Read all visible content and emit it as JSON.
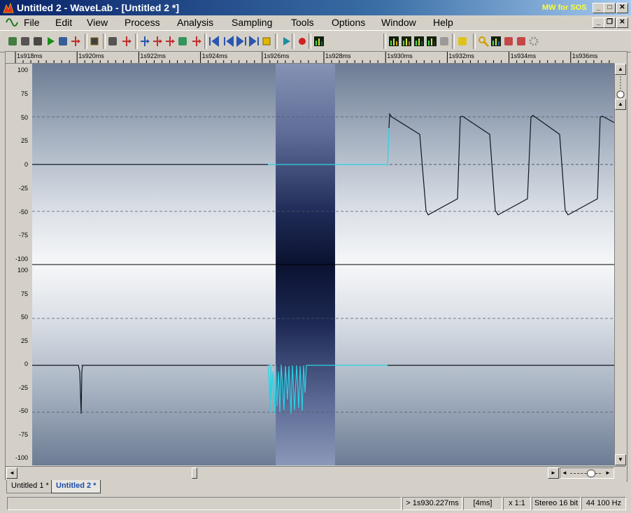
{
  "window": {
    "title": "Untitled 2 - WaveLab - [Untitled 2 *]",
    "brand": "MW for SOS",
    "controls": {
      "minimize": "_",
      "maximize": "□",
      "close": "✕"
    },
    "mdi_controls": {
      "minimize": "_",
      "restore": "❐",
      "close": "✕"
    }
  },
  "menu": [
    "File",
    "Edit",
    "View",
    "Process",
    "Analysis",
    "Sampling",
    "Tools",
    "Options",
    "Window",
    "Help"
  ],
  "toolbar_icons": [
    "new-icon",
    "settings-icon",
    "camera-icon",
    "play-record-icon",
    "monitor-icon",
    "marker-icon",
    "stopwatch-icon",
    "microphone-icon",
    "marker-set-icon",
    "marker-move-icon",
    "marker-red-icon",
    "marker-multi-icon",
    "loop-icon",
    "marker-delete-icon",
    "go-start-icon",
    "rewind-icon",
    "forward-icon",
    "go-end-icon",
    "stop-icon",
    "play-icon",
    "record-icon",
    "spectrum-icon",
    "meter-icon",
    "analyzer-icon",
    "eq-icon",
    "bars-icon",
    "disabled-icon",
    "speaker-icon",
    "magnifier-icon",
    "pause-bars-icon",
    "route-icon",
    "fx-icon",
    "gear-icon"
  ],
  "ruler": {
    "labels": [
      "1s918ms",
      "1s920ms",
      "1s922ms",
      "1s924ms",
      "1s926ms",
      "1s928ms",
      "1s930ms",
      "1s932ms",
      "1s934ms",
      "1s936ms"
    ]
  },
  "y_axis": {
    "top_channel": [
      "100",
      "75",
      "50",
      "25",
      "0",
      "-25",
      "-50",
      "-75",
      "-100"
    ],
    "bottom_channel": [
      "100",
      "75",
      "50",
      "25",
      "0",
      "-25",
      "-50",
      "-75",
      "-100"
    ]
  },
  "waveform": {
    "selection_ms": [
      1925.9,
      1927.9
    ],
    "range_ms": [
      1917.7,
      1937.3
    ],
    "colors": {
      "wave": "#10161e",
      "selected_wave": "#29d3e3",
      "selection_bg": "#1c2a5c"
    }
  },
  "scroll": {
    "left": "◄",
    "right": "►",
    "up": "▲",
    "down": "▼"
  },
  "tabs": [
    {
      "label": "Untitled 1 *",
      "active": false
    },
    {
      "label": "Untitled 2 *",
      "active": true
    }
  ],
  "status": {
    "position": "> 1s930.227ms",
    "span": "[4ms]",
    "zoom": "x 1:1",
    "format": "Stereo 16 bit",
    "rate": "44 100 Hz"
  }
}
